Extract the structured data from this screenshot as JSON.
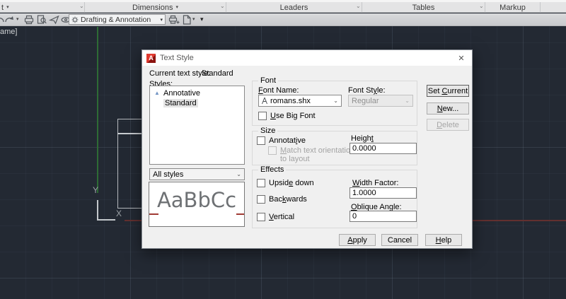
{
  "icons": {
    "close": "✕",
    "chevron": "⌄",
    "arrow_down": "▾",
    "launcher": "⌄",
    "annotative_triangle": "▲",
    "autocad_logo_letter": "A",
    "ucs_x": "X",
    "ucs_y": "Y"
  },
  "colors": {
    "canvas_bg": "#232933",
    "axis_green": "#2e6b35",
    "axis_red": "#63302f",
    "dialog_bg": "#f0f0f0",
    "autocad_logo_red": "#e03a30"
  },
  "ribbon": {
    "panels": [
      {
        "label": "t",
        "has_arrow": true
      },
      {
        "label": "Dimensions",
        "has_arrow": true
      },
      {
        "label": "Leaders",
        "has_arrow": false
      },
      {
        "label": "Tables",
        "has_arrow": false
      },
      {
        "label": "Markup",
        "has_arrow": false
      }
    ]
  },
  "qat": {
    "workspace": "Drafting & Annotation"
  },
  "canvas": {
    "viewport_label_partial": "ame]"
  },
  "dialog": {
    "title": "Text Style",
    "current_label": "Current text style:",
    "current_value": "Standard",
    "styles_label": {
      "pre": "",
      "u": "S",
      "post": "tyles:"
    },
    "styles": [
      {
        "label": "Annotative"
      },
      {
        "label": "Standard"
      }
    ],
    "filter_value": "All styles",
    "preview_text": "AaBbCc",
    "font": {
      "title": "Font",
      "name_label": {
        "pre": "",
        "u": "F",
        "post": "ont Name:"
      },
      "name_value": "romans.shx",
      "style_label": {
        "pre": "Font St",
        "u": "y",
        "post": "le:"
      },
      "style_value": "Regular",
      "big_font_label": {
        "pre": "",
        "u": "U",
        "post": "se Big Font"
      }
    },
    "size": {
      "title": "Size",
      "annotative_label": {
        "pre": "Annotat",
        "u": "i",
        "post": "ve"
      },
      "match_line1": {
        "pre": "",
        "u": "M",
        "post": "atch text orientation"
      },
      "match_line2": "to layout",
      "height_label": {
        "pre": "Heigh",
        "u": "t",
        "post": ""
      },
      "height_value": "0.0000"
    },
    "effects": {
      "title": "Effects",
      "upside_down_label": {
        "pre": "Upsid",
        "u": "e",
        "post": " down"
      },
      "backwards_label": {
        "pre": "Bac",
        "u": "k",
        "post": "wards"
      },
      "vertical_label": {
        "pre": "",
        "u": "V",
        "post": "ertical"
      },
      "width_factor_label": {
        "pre": "",
        "u": "W",
        "post": "idth Factor:"
      },
      "width_factor_value": "1.0000",
      "oblique_label": {
        "pre": "",
        "u": "O",
        "post": "blique Angle:"
      },
      "oblique_value": "0"
    },
    "buttons": {
      "set_current": {
        "pre": "Set ",
        "u": "C",
        "post": "urrent"
      },
      "new": {
        "pre": "",
        "u": "N",
        "post": "ew..."
      },
      "delete": {
        "pre": "",
        "u": "D",
        "post": "elete"
      },
      "apply": {
        "pre": "",
        "u": "A",
        "post": "pply"
      },
      "cancel": "Cancel",
      "help": {
        "pre": "",
        "u": "H",
        "post": "elp"
      }
    }
  }
}
